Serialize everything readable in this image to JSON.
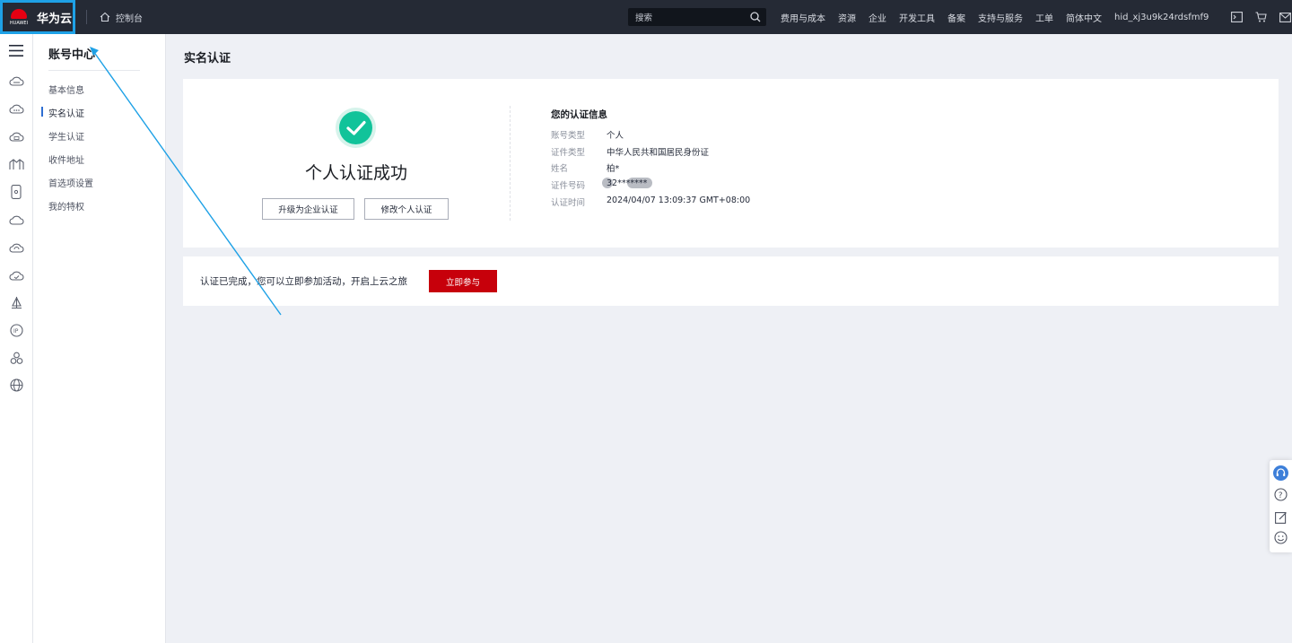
{
  "topbar": {
    "brand_wordmark": "HUAWEI",
    "brand_name": "华为云",
    "console_label": "控制台",
    "search_placeholder": "搜索",
    "nav": [
      "费用与成本",
      "资源",
      "企业",
      "开发工具",
      "备案",
      "支持与服务",
      "工单",
      "简体中文",
      "hid_xj3u9k24rdsfmf9"
    ],
    "icons": [
      "terminal-icon",
      "cart-icon",
      "mail-icon"
    ]
  },
  "rail": {
    "icons": [
      "menu-icon",
      "cloud-server-icon",
      "cloud-dots-icon",
      "cloud-db-icon",
      "bridge-icon",
      "mobile-icon",
      "cloud-icon",
      "cloud-sync-icon",
      "cloud-check-icon",
      "sail-icon",
      "ip-icon",
      "cluster-icon",
      "globe-icon"
    ]
  },
  "sidebar": {
    "title": "账号中心",
    "items": [
      {
        "label": "基本信息",
        "active": false
      },
      {
        "label": "实名认证",
        "active": true
      },
      {
        "label": "学生认证",
        "active": false
      },
      {
        "label": "收件地址",
        "active": false
      },
      {
        "label": "首选项设置",
        "active": false
      },
      {
        "label": "我的特权",
        "active": false
      }
    ]
  },
  "main": {
    "page_title": "实名认证",
    "success_text": "个人认证成功",
    "buttons": {
      "upgrade": "升级为企业认证",
      "modify": "修改个人认证"
    },
    "info": {
      "title": "您的认证信息",
      "rows": [
        {
          "label": "账号类型",
          "value": "个人"
        },
        {
          "label": "证件类型",
          "value": "中华人民共和国居民身份证"
        },
        {
          "label": "姓名",
          "value": "柏*"
        },
        {
          "label": "证件号码",
          "value": "32*******"
        },
        {
          "label": "认证时间",
          "value": "2024/04/07 13:09:37 GMT+08:00"
        }
      ]
    },
    "promo_text": "认证已完成，您可以立即参加活动，开启上云之旅",
    "join_button": "立即参与"
  },
  "float_tools": [
    "headset-icon",
    "help-icon",
    "edit-icon",
    "smile-icon"
  ],
  "colors": {
    "accent": "#1ea1e6",
    "primary_red": "#c7000b",
    "success_green": "#11c39a",
    "topbar": "#252a35"
  }
}
